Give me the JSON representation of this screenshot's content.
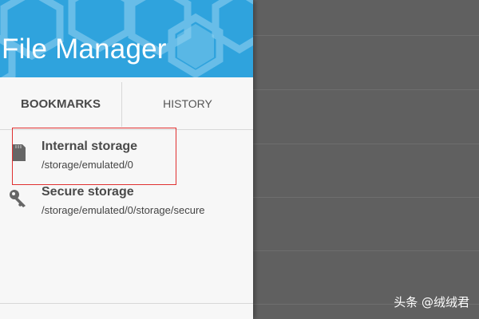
{
  "app": {
    "title": "File Manager"
  },
  "tabs": [
    {
      "label": "BOOKMARKS",
      "selected": true
    },
    {
      "label": "HISTORY",
      "selected": false
    }
  ],
  "bookmarks": [
    {
      "name": "Internal storage",
      "path": "/storage/emulated/0",
      "icon": "sd-card-icon",
      "highlighted": true
    },
    {
      "name": "Secure storage",
      "path": "/storage/emulated/0/storage/secure",
      "icon": "key-icon",
      "highlighted": false
    }
  ],
  "watermark": "头条 @绒绒君",
  "colors": {
    "header": "#2fa3dd",
    "highlight": "#e03030",
    "drawer_bg": "#f7f7f7",
    "scrim": "#606060"
  }
}
